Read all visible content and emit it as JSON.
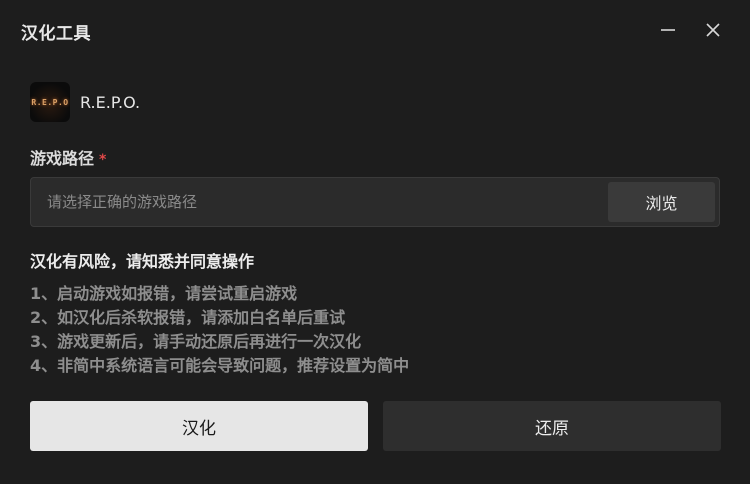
{
  "window": {
    "title": "汉化工具",
    "minimize_icon": "minimize-icon",
    "close_icon": "close-icon"
  },
  "app": {
    "logo_text": "R.E.P.O",
    "name": "R.E.P.O."
  },
  "game_path": {
    "label": "游戏路径",
    "required_mark": "*",
    "value": "",
    "placeholder": "请选择正确的游戏路径",
    "browse_label": "浏览"
  },
  "warning": {
    "title": "汉化有风险，请知悉并同意操作",
    "items": [
      "1、启动游戏如报错，请尝试重启游戏",
      "2、如汉化后杀软报错，请添加白名单后重试",
      "3、游戏更新后，请手动还原后再进行一次汉化",
      "4、非简中系统语言可能会导致问题，推荐设置为简中"
    ]
  },
  "actions": {
    "localize_label": "汉化",
    "restore_label": "还原"
  },
  "colors": {
    "background": "#1d1d1d",
    "required": "#e04848",
    "primary_button": "#e6e6e6",
    "secondary_button": "#2e2e2e"
  }
}
